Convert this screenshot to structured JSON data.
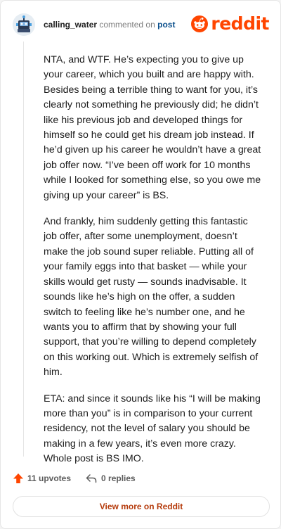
{
  "header": {
    "username": "calling_water",
    "action_text": "commented on",
    "post_link": "post",
    "brand": "reddit"
  },
  "comment": {
    "paragraphs": [
      "NTA, and WTF. He’s expecting you to give up your career, which you built and are happy with. Besides being a terrible thing to want for you, it’s clearly not something he previously did; he didn’t like his previous job and developed things for himself so he could get his dream job instead. If he’d given up his career he wouldn’t have a great job offer now. “I’ve been off work for 10 months while I looked for something else, so you owe me giving up your career” is BS.",
      "And frankly, him suddenly getting this fantastic job offer, after some unemployment, doesn’t make the job sound super reliable. Putting all of your family eggs into that basket — while your skills would get rusty — sounds inadvisable. It sounds like he’s high on the offer, a sudden switch to feeling like he’s number one, and he wants you to affirm that by showing your full support, that you’re willing to depend completely on this working out. Which is extremely selfish of him.",
      "ETA: and since it sounds like his “I will be making more than you” is in comparison to your current residency, not the level of salary you should be making in a few years, it’s even more crazy. Whole post is BS IMO."
    ]
  },
  "footer": {
    "upvotes": "11 upvotes",
    "replies": "0 replies",
    "view_more": "View more on Reddit"
  },
  "colors": {
    "brand": "#ff4500",
    "upvote_arrow": "#ff4500",
    "link": "#0a4f8c",
    "button_text": "#b53b0c"
  },
  "icons": {
    "avatar": "robot-avatar-icon",
    "logo": "reddit-snoo-icon",
    "upvote": "upvote-arrow-icon",
    "reply": "reply-arrow-icon"
  }
}
